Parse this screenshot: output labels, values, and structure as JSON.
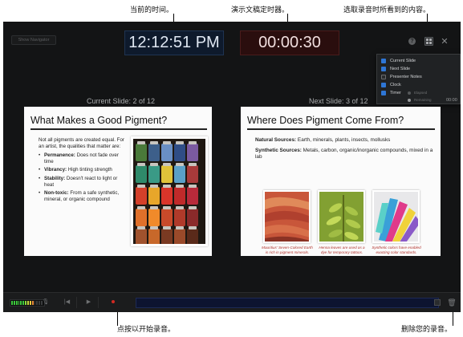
{
  "callouts": {
    "current_time": "当前的时间。",
    "rehearsal_timer": "演示文稿定时器。",
    "select_view": "选取录音时所看到的内容。",
    "record": "点按以开始录音。",
    "delete": "删除您的录音。"
  },
  "toolbar": {
    "show_navigator": "Show Navigator",
    "clock": "12:12:51 PM",
    "timer": "00:00:30",
    "help_icon": "question-icon",
    "layout_icon": "grid-layout-icon",
    "close_icon": "close-icon"
  },
  "layout_menu": {
    "items": [
      {
        "label": "Current Slide",
        "checked": true
      },
      {
        "label": "Next Slide",
        "checked": true
      },
      {
        "label": "Presenter Notes",
        "checked": false
      },
      {
        "label": "Clock",
        "checked": true
      },
      {
        "label": "Timer",
        "checked": true
      }
    ],
    "timer_modes": [
      {
        "label": "Elapsed",
        "selected": false
      },
      {
        "label": "Remaining",
        "selected": true
      }
    ],
    "timer_value": "00:00"
  },
  "current_slide": {
    "label": "Current Slide: 2 of 12",
    "title": "What Makes a Good Pigment?",
    "intro": "Not all pigments are created equal. For an artist, the qualities that matter are:",
    "bullets": [
      {
        "term": "Permanence:",
        "text": " Does not fade over time"
      },
      {
        "term": "Vibrancy:",
        "text": " High tinting strength"
      },
      {
        "term": "Stability:",
        "text": " Doesn't react to light or heat"
      },
      {
        "term": "Non-toxic:",
        "text": " From a safe synthetic, mineral, or organic compound"
      }
    ]
  },
  "next_slide": {
    "label": "Next Slide: 3 of 12",
    "title": "Where Does Pigment Come From?",
    "natural_term": "Natural Sources:",
    "natural_text": " Earth, minerals, plants, insects, mollusks",
    "synthetic_term": "Synthetic Sources:",
    "synthetic_text": " Metals, carbon, organic/inorganic compounds, mixed in a lab",
    "captions": [
      "Mauritius' Seven-Colored Earth is rich in pigment minerals.",
      "Henna leaves are used as a dye for temporary tattoos.",
      "Synthetic colors have enabled exacting color standards."
    ]
  },
  "bottom_bar": {
    "mic_icon": "microphone-icon",
    "prev_icon": "skip-back-icon",
    "play_icon": "play-icon",
    "record_icon": "record-icon",
    "delete_icon": "trash-icon"
  },
  "colors": {
    "accent_blue": "#2e76d6",
    "record_red": "#d22a22",
    "caption_red": "#b0302a"
  }
}
